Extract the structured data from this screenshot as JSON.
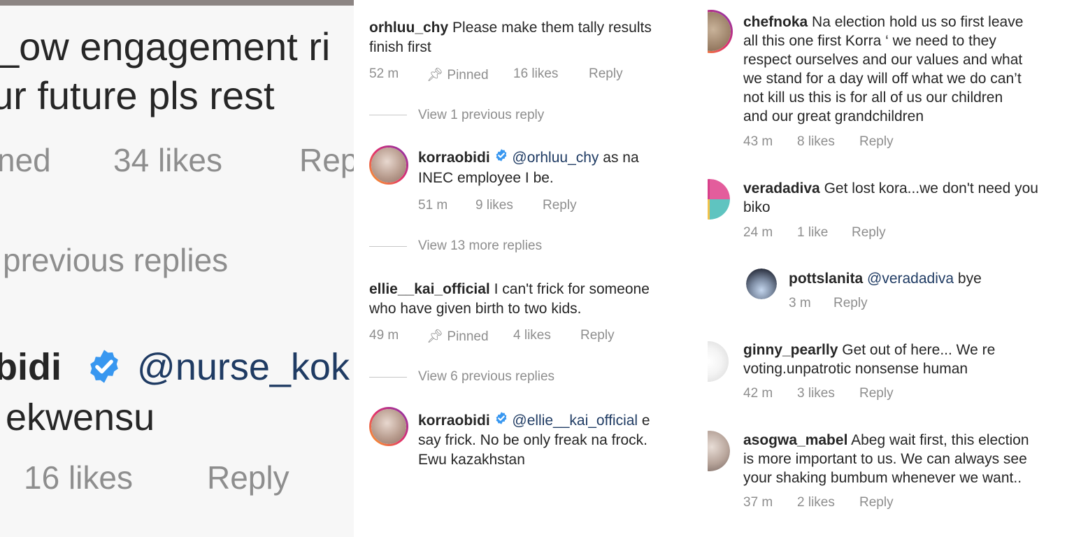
{
  "panel1": {
    "line1": "_ow engagement ri",
    "line2": "ur future pls rest",
    "pinned": "ned",
    "likes": "34 likes",
    "reply": "Rep",
    "view_replies": "previous replies",
    "username": "bidi",
    "mention": "@nurse_kok",
    "line3": "ekwensu",
    "likes2": "16 likes",
    "reply2": "Reply"
  },
  "panel2": {
    "comments": [
      {
        "user": "orhluu_chy",
        "text1": "Please make them tally results",
        "text2": "finish first",
        "time": "52 m",
        "pinned": "Pinned",
        "likes": "16 likes",
        "reply": "Reply",
        "view": "View 1 previous reply"
      },
      {
        "user": "korraobidi",
        "mention": "@orhluu_chy",
        "text1": "as na",
        "text2": "INEC employee I be.",
        "time": "51 m",
        "likes": "9 likes",
        "reply": "Reply",
        "view": "View 13 more replies"
      },
      {
        "user": "ellie__kai_official",
        "text1": "I can't frick for someone",
        "text2": "who have given birth to two kids.",
        "time": "49 m",
        "pinned": "Pinned",
        "likes": "4 likes",
        "reply": "Reply",
        "view": "View 6 previous replies"
      },
      {
        "user": "korraobidi",
        "mention": "@ellie__kai_official",
        "text1": "e",
        "text2": "say frick. No be only freak na frock.",
        "text3": "Ewu kazakhstan"
      }
    ]
  },
  "panel3": {
    "comments": [
      {
        "user": "chefnoka",
        "lines": [
          "Na election hold us so first leave",
          "all this one first Korra ‘ we need to they",
          "respect ourselves and our values and what",
          "we stand for a day will off what we do can’t",
          "not kill us this is for all of us our children",
          "and our great grandchildren"
        ],
        "time": "43 m",
        "likes": "8 likes",
        "reply": "Reply"
      },
      {
        "user": "veradadiva",
        "lines": [
          "Get lost kora...we don't need you",
          "biko"
        ],
        "time": "24 m",
        "likes": "1 like",
        "reply": "Reply"
      },
      {
        "user": "pottslanita",
        "mention": "@veradadiva",
        "text": "bye",
        "time": "3 m",
        "reply": "Reply"
      },
      {
        "user": "ginny_pearlly",
        "lines": [
          "Get out of here... We re",
          "voting.unpatrotic nonsense human"
        ],
        "time": "42 m",
        "likes": "3 likes",
        "reply": "Reply"
      },
      {
        "user": "asogwa_mabel",
        "lines": [
          "Abeg wait first, this election",
          "is more important to us. We can always see",
          "your shaking bumbum whenever we want.."
        ],
        "time": "37 m",
        "likes": "2 likes",
        "reply": "Reply"
      }
    ]
  },
  "colors": {
    "accent": "#3897f0",
    "text": "#262626",
    "meta": "#8e8e8e",
    "mention": "#1f3b63"
  }
}
